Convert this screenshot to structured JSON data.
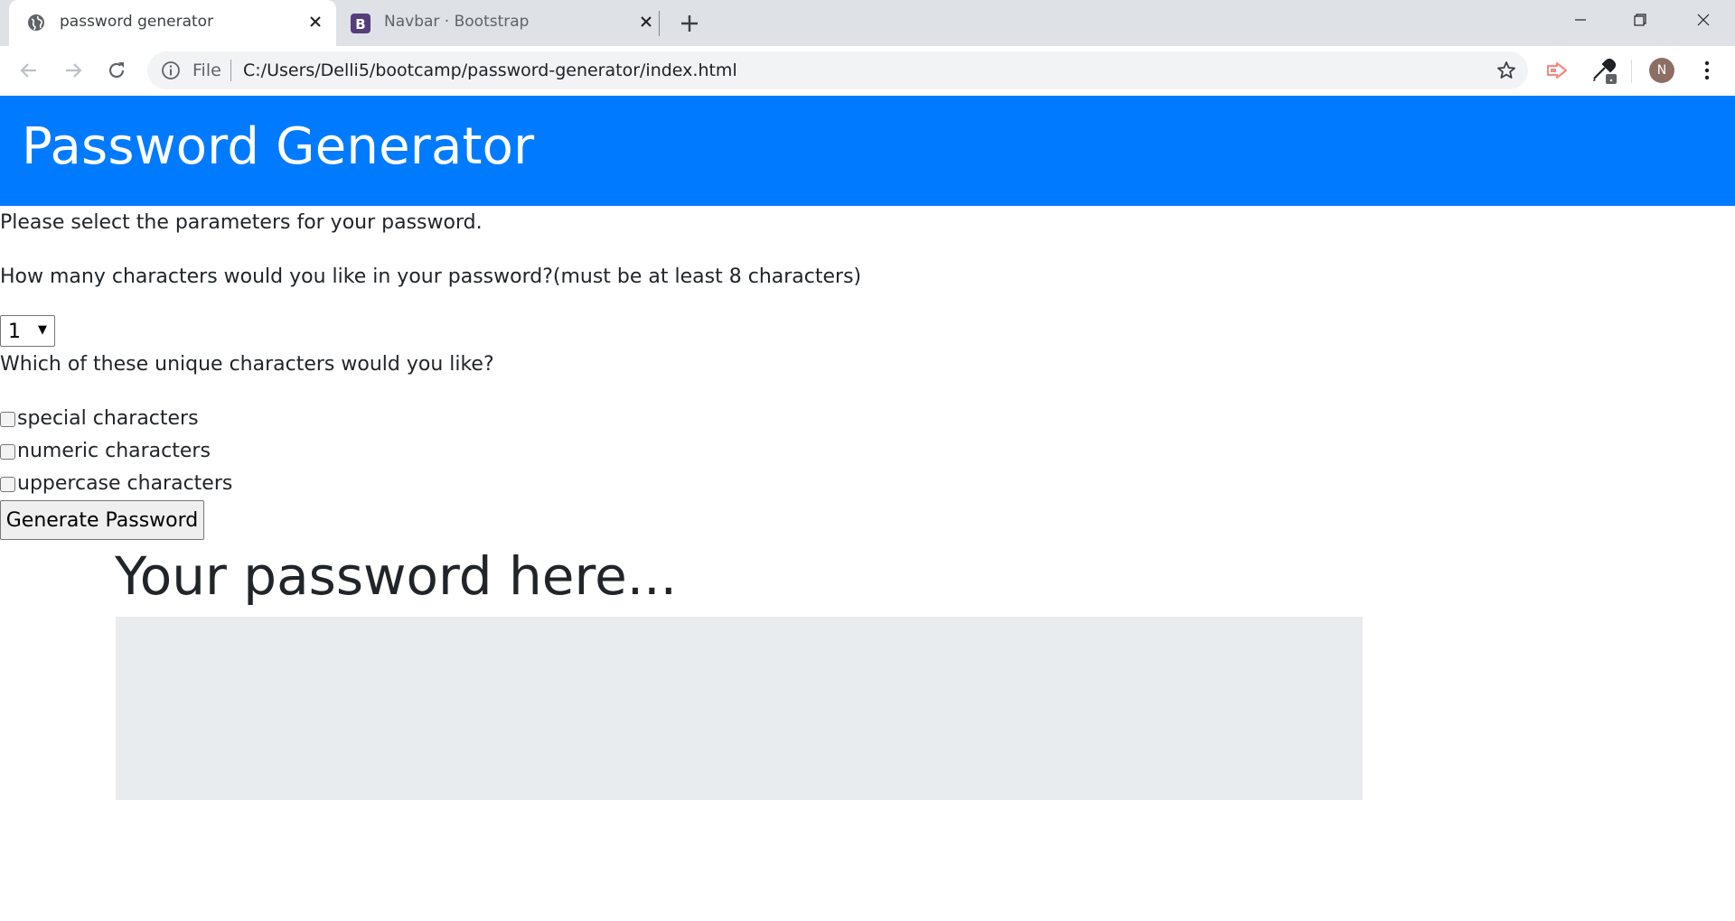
{
  "browser": {
    "tabs": [
      {
        "title": "password generator",
        "favicon": "globe-icon",
        "active": true
      },
      {
        "title": "Navbar · Bootstrap",
        "favicon": "bootstrap-icon",
        "active": false
      }
    ],
    "address": {
      "scheme_label": "File",
      "url": "C:/Users/Delli5/bootcamp/password-generator/index.html"
    },
    "avatar_initial": "N",
    "icons": [
      "back-icon",
      "forward-icon",
      "reload-icon",
      "info-icon",
      "star-icon",
      "extension-arrow-icon",
      "eyedropper-icon",
      "menu-dots-icon",
      "minimize-icon",
      "restore-icon",
      "close-window-icon"
    ]
  },
  "page": {
    "header": {
      "title": "Password Generator",
      "bg_color": "#007bff"
    },
    "intro": "Please select the parameters for your password.",
    "length_prompt": "How many characters would you like in your password?(must be at least 8 characters)",
    "length_select": {
      "value": "1"
    },
    "unique_prompt": "Which of these unique characters would you like?",
    "options": [
      {
        "label": "special characters",
        "checked": false
      },
      {
        "label": "numeric characters",
        "checked": false
      },
      {
        "label": "uppercase characters",
        "checked": false
      }
    ],
    "generate_button": "Generate Password",
    "result_heading": "Your password here...",
    "result_box_color": "#e9ecef"
  }
}
